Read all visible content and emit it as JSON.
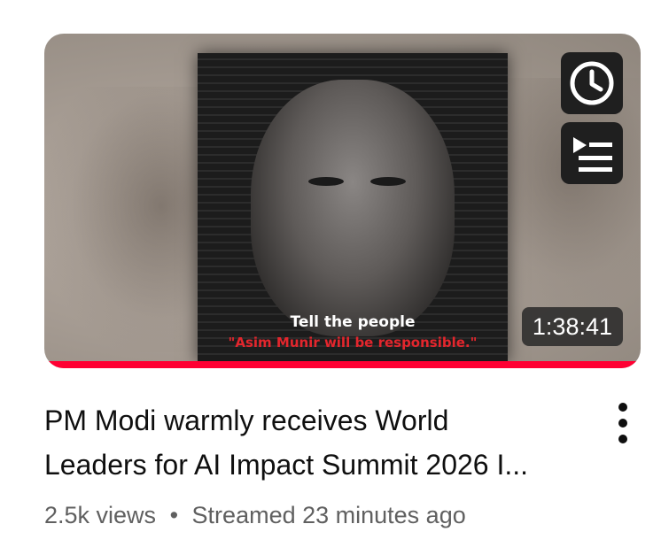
{
  "video": {
    "title_line1": "PM Modi warmly receives World",
    "title_line2": "Leaders for AI Impact Summit 2026 I...",
    "views": "2.5k views",
    "separator": "•",
    "streamed": "Streamed 23 minutes ago",
    "duration": "1:38:41",
    "progress_percent": 100,
    "progress_color": "#ff0033"
  },
  "thumbnail": {
    "caption_line1": "Tell the people",
    "caption_line2": "\"Asim Munir will be responsible.\""
  },
  "icons": {
    "watch_later": "clock-icon",
    "add_to_queue": "queue-icon",
    "more": "vertical-dots-icon"
  }
}
